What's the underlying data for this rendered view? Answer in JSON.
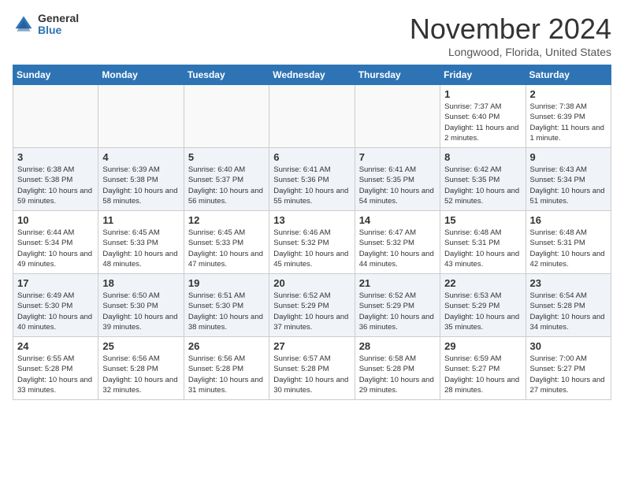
{
  "logo": {
    "general": "General",
    "blue": "Blue"
  },
  "header": {
    "month": "November 2024",
    "location": "Longwood, Florida, United States"
  },
  "weekdays": [
    "Sunday",
    "Monday",
    "Tuesday",
    "Wednesday",
    "Thursday",
    "Friday",
    "Saturday"
  ],
  "weeks": [
    [
      {
        "day": "",
        "info": ""
      },
      {
        "day": "",
        "info": ""
      },
      {
        "day": "",
        "info": ""
      },
      {
        "day": "",
        "info": ""
      },
      {
        "day": "",
        "info": ""
      },
      {
        "day": "1",
        "info": "Sunrise: 7:37 AM\nSunset: 6:40 PM\nDaylight: 11 hours and 2 minutes."
      },
      {
        "day": "2",
        "info": "Sunrise: 7:38 AM\nSunset: 6:39 PM\nDaylight: 11 hours and 1 minute."
      }
    ],
    [
      {
        "day": "3",
        "info": "Sunrise: 6:38 AM\nSunset: 5:38 PM\nDaylight: 10 hours and 59 minutes."
      },
      {
        "day": "4",
        "info": "Sunrise: 6:39 AM\nSunset: 5:38 PM\nDaylight: 10 hours and 58 minutes."
      },
      {
        "day": "5",
        "info": "Sunrise: 6:40 AM\nSunset: 5:37 PM\nDaylight: 10 hours and 56 minutes."
      },
      {
        "day": "6",
        "info": "Sunrise: 6:41 AM\nSunset: 5:36 PM\nDaylight: 10 hours and 55 minutes."
      },
      {
        "day": "7",
        "info": "Sunrise: 6:41 AM\nSunset: 5:35 PM\nDaylight: 10 hours and 54 minutes."
      },
      {
        "day": "8",
        "info": "Sunrise: 6:42 AM\nSunset: 5:35 PM\nDaylight: 10 hours and 52 minutes."
      },
      {
        "day": "9",
        "info": "Sunrise: 6:43 AM\nSunset: 5:34 PM\nDaylight: 10 hours and 51 minutes."
      }
    ],
    [
      {
        "day": "10",
        "info": "Sunrise: 6:44 AM\nSunset: 5:34 PM\nDaylight: 10 hours and 49 minutes."
      },
      {
        "day": "11",
        "info": "Sunrise: 6:45 AM\nSunset: 5:33 PM\nDaylight: 10 hours and 48 minutes."
      },
      {
        "day": "12",
        "info": "Sunrise: 6:45 AM\nSunset: 5:33 PM\nDaylight: 10 hours and 47 minutes."
      },
      {
        "day": "13",
        "info": "Sunrise: 6:46 AM\nSunset: 5:32 PM\nDaylight: 10 hours and 45 minutes."
      },
      {
        "day": "14",
        "info": "Sunrise: 6:47 AM\nSunset: 5:32 PM\nDaylight: 10 hours and 44 minutes."
      },
      {
        "day": "15",
        "info": "Sunrise: 6:48 AM\nSunset: 5:31 PM\nDaylight: 10 hours and 43 minutes."
      },
      {
        "day": "16",
        "info": "Sunrise: 6:48 AM\nSunset: 5:31 PM\nDaylight: 10 hours and 42 minutes."
      }
    ],
    [
      {
        "day": "17",
        "info": "Sunrise: 6:49 AM\nSunset: 5:30 PM\nDaylight: 10 hours and 40 minutes."
      },
      {
        "day": "18",
        "info": "Sunrise: 6:50 AM\nSunset: 5:30 PM\nDaylight: 10 hours and 39 minutes."
      },
      {
        "day": "19",
        "info": "Sunrise: 6:51 AM\nSunset: 5:30 PM\nDaylight: 10 hours and 38 minutes."
      },
      {
        "day": "20",
        "info": "Sunrise: 6:52 AM\nSunset: 5:29 PM\nDaylight: 10 hours and 37 minutes."
      },
      {
        "day": "21",
        "info": "Sunrise: 6:52 AM\nSunset: 5:29 PM\nDaylight: 10 hours and 36 minutes."
      },
      {
        "day": "22",
        "info": "Sunrise: 6:53 AM\nSunset: 5:29 PM\nDaylight: 10 hours and 35 minutes."
      },
      {
        "day": "23",
        "info": "Sunrise: 6:54 AM\nSunset: 5:28 PM\nDaylight: 10 hours and 34 minutes."
      }
    ],
    [
      {
        "day": "24",
        "info": "Sunrise: 6:55 AM\nSunset: 5:28 PM\nDaylight: 10 hours and 33 minutes."
      },
      {
        "day": "25",
        "info": "Sunrise: 6:56 AM\nSunset: 5:28 PM\nDaylight: 10 hours and 32 minutes."
      },
      {
        "day": "26",
        "info": "Sunrise: 6:56 AM\nSunset: 5:28 PM\nDaylight: 10 hours and 31 minutes."
      },
      {
        "day": "27",
        "info": "Sunrise: 6:57 AM\nSunset: 5:28 PM\nDaylight: 10 hours and 30 minutes."
      },
      {
        "day": "28",
        "info": "Sunrise: 6:58 AM\nSunset: 5:28 PM\nDaylight: 10 hours and 29 minutes."
      },
      {
        "day": "29",
        "info": "Sunrise: 6:59 AM\nSunset: 5:27 PM\nDaylight: 10 hours and 28 minutes."
      },
      {
        "day": "30",
        "info": "Sunrise: 7:00 AM\nSunset: 5:27 PM\nDaylight: 10 hours and 27 minutes."
      }
    ]
  ]
}
